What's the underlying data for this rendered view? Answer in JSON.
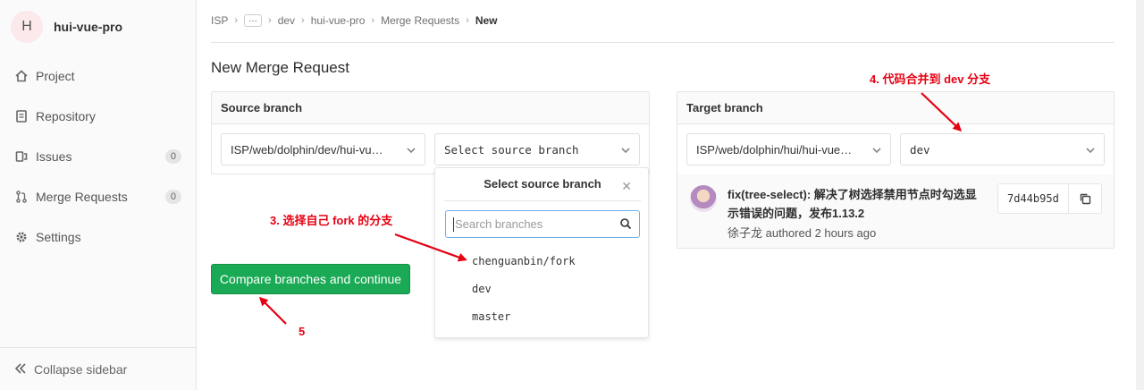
{
  "sidebar": {
    "avatar_letter": "H",
    "project_name": "hui-vue-pro",
    "items": [
      {
        "label": "Project",
        "icon": "home-icon"
      },
      {
        "label": "Repository",
        "icon": "document-icon"
      },
      {
        "label": "Issues",
        "icon": "issues-icon",
        "count": "0"
      },
      {
        "label": "Merge Requests",
        "icon": "merge-request-icon",
        "count": "0"
      },
      {
        "label": "Settings",
        "icon": "gear-icon"
      }
    ],
    "collapse_label": "Collapse sidebar"
  },
  "breadcrumb": {
    "items": [
      "ISP",
      "…",
      "dev",
      "hui-vue-pro",
      "Merge Requests"
    ],
    "current": "New"
  },
  "page_title": "New Merge Request",
  "source": {
    "header": "Source branch",
    "project_value": "ISP/web/dolphin/dev/hui-vu…",
    "branch_placeholder": "Select source branch",
    "dropdown": {
      "title": "Select source branch",
      "search_placeholder": "Search branches",
      "branches": [
        "chenguanbin/fork",
        "dev",
        "master"
      ]
    }
  },
  "target": {
    "header": "Target branch",
    "project_value": "ISP/web/dolphin/hui/hui-vue…",
    "branch_value": "dev",
    "commit": {
      "title": "fix(tree-select): 解决了树选择禁用节点时勾选显示错误的问题，发布1.13.2",
      "author": "徐子龙",
      "authored_text": "authored 2 hours ago",
      "sha": "7d44b95d"
    }
  },
  "compare_button": "Compare branches and continue",
  "annotations": {
    "step3": "3. 选择自己 fork 的分支",
    "step4": "4. 代码合并到 dev 分支",
    "step5": "5"
  },
  "colors": {
    "annotation": "#e60012",
    "primary_button": "#1aaa55",
    "focus_border": "#73afea"
  }
}
